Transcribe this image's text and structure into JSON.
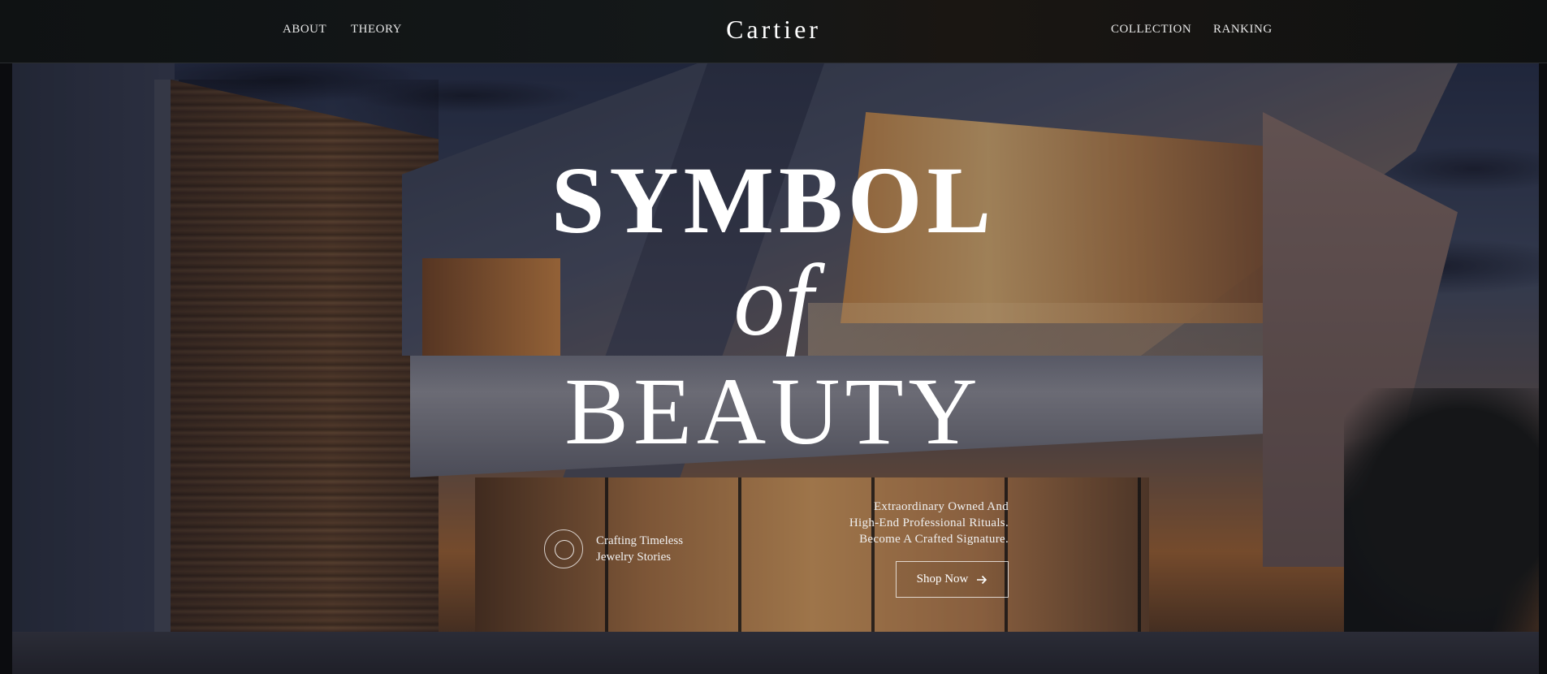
{
  "header": {
    "brand": "Cartier",
    "nav_left": [
      "ABOUT",
      "THEORY"
    ],
    "nav_right": [
      "COLLECTION",
      "RANKING"
    ]
  },
  "hero": {
    "headline_line1": "SYMBOL",
    "headline_line2": "of",
    "headline_line3": "BEAUTY"
  },
  "feature": {
    "icon": "concentric-circle-icon",
    "line1": "Crafting Timeless",
    "line2": "Jewelry Stories"
  },
  "description": {
    "line1": "Extraordinary Owned And",
    "line2": "High-End Professional Rituals.",
    "line3": "Become A Crafted Signature."
  },
  "cta": {
    "label": "Shop Now",
    "icon": "arrow-right-icon"
  },
  "colors": {
    "header_bg": "#141819",
    "text": "#ffffff"
  }
}
